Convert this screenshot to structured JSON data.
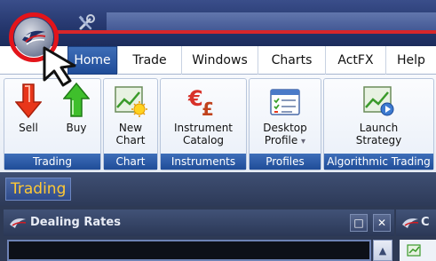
{
  "tabs": [
    {
      "label": "Home",
      "active": true
    },
    {
      "label": "Trade",
      "active": false
    },
    {
      "label": "Windows",
      "active": false
    },
    {
      "label": "Charts",
      "active": false
    },
    {
      "label": "ActFX",
      "active": false
    },
    {
      "label": "Help",
      "active": false
    }
  ],
  "ribbon": {
    "groups": {
      "trading": {
        "label": "Trading",
        "sell": "Sell",
        "buy": "Buy"
      },
      "chart": {
        "label": "Chart",
        "new_chart_line1": "New",
        "new_chart_line2": "Chart"
      },
      "instruments": {
        "label": "Instruments",
        "catalog_line1": "Instrument",
        "catalog_line2": "Catalog"
      },
      "profiles": {
        "label": "Profiles",
        "desktop_line1": "Desktop",
        "desktop_line2": "Profile",
        "dropdown_glyph": "▾"
      },
      "algorithmic": {
        "label": "Algorithmic Trading",
        "launch_line1": "Launch",
        "launch_line2": "Strategy"
      }
    }
  },
  "workspace": {
    "trading_tab": "Trading",
    "dealing_rates_title": "Dealing Rates",
    "restore_glyph": "□",
    "close_glyph": "✕",
    "scroll_up_glyph": "▲",
    "right_panel_title_fragment": "C"
  },
  "colors": {
    "sell_arrow": "#e8361a",
    "buy_arrow": "#3fbf2c",
    "accent_red": "#e3141a",
    "tab_active": "#1f4c98",
    "trading_text": "#ffc935"
  },
  "icons": {
    "app_orb": "app-orb-icon",
    "qat_tools": "tools-icon",
    "sell": "down-arrow-icon",
    "buy": "up-arrow-icon",
    "new_chart": "chart-sun-icon",
    "instrument_catalog": "currency-icon",
    "desktop_profile": "checklist-icon",
    "launch_strategy": "chart-play-icon",
    "pointer": "mouse-pointer-icon"
  }
}
